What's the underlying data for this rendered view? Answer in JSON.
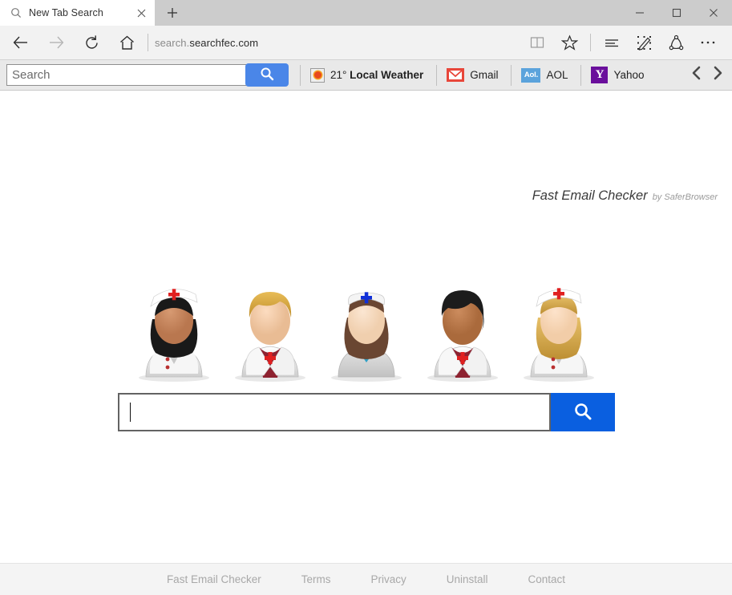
{
  "window": {
    "controls": {
      "minimize": "minimize-button",
      "maximize": "maximize-button",
      "close": "close-button"
    }
  },
  "tabs": [
    {
      "title": "New Tab Search",
      "favicon": "search-icon",
      "active": true
    }
  ],
  "newtab_label": "+",
  "navbar": {
    "back": "back-arrow-icon",
    "forward": "forward-arrow-icon",
    "refresh": "refresh-icon",
    "home": "home-icon",
    "url_dim": "search.",
    "url_bold": "searchfec.com",
    "right_icons": [
      "reading-view-icon",
      "favorites-star-icon",
      "hub-icon",
      "web-note-icon",
      "share-icon",
      "more-icon"
    ]
  },
  "toolbar": {
    "search_placeholder": "Search",
    "search_value": "",
    "search_button_icon": "magnifier-icon",
    "links": [
      {
        "label_prefix": "21° ",
        "label": "Local Weather",
        "icon": "weather-sun-icon"
      },
      {
        "label_prefix": "",
        "label": "Gmail",
        "icon": "gmail-envelope-icon"
      },
      {
        "label_prefix": "",
        "label": "AOL",
        "icon": "aol-icon",
        "icon_text": "Aol."
      },
      {
        "label_prefix": "",
        "label": "Yahoo",
        "icon": "yahoo-icon",
        "icon_text": "Y"
      }
    ],
    "prev_arrow": "chevron-left-icon",
    "next_arrow": "chevron-right-icon"
  },
  "branding": {
    "title": "Fast Email Checker",
    "by": "by SaferBrowser"
  },
  "hero": {
    "avatars": [
      {
        "name": "nurse-dark-hair-red-cross-cap"
      },
      {
        "name": "doctor-blond-hair"
      },
      {
        "name": "nurse-brown-hair-blue-cross-cap"
      },
      {
        "name": "doctor-dark-hair"
      },
      {
        "name": "nurse-blonde-hair-red-cross-cap"
      }
    ],
    "search_value": "",
    "search_placeholder": "",
    "search_button_icon": "magnifier-icon",
    "accent_color": "#0a5fe0"
  },
  "footer": {
    "links": [
      "Fast Email Checker",
      "Terms",
      "Privacy",
      "Uninstall",
      "Contact"
    ]
  },
  "colors": {
    "tabstrip_bg": "#cccccc",
    "navbar_bg": "#f2f2f2",
    "sbtoolbar_bg": "#e9e9e9",
    "toolbar_button_blue": "#4a86e8",
    "hero_button_blue": "#0a5fe0",
    "footer_bg": "#f4f4f4",
    "gmail_red": "#e8463a",
    "aol_blue": "#5ba3dc",
    "yahoo_purple": "#6a0f9c"
  }
}
